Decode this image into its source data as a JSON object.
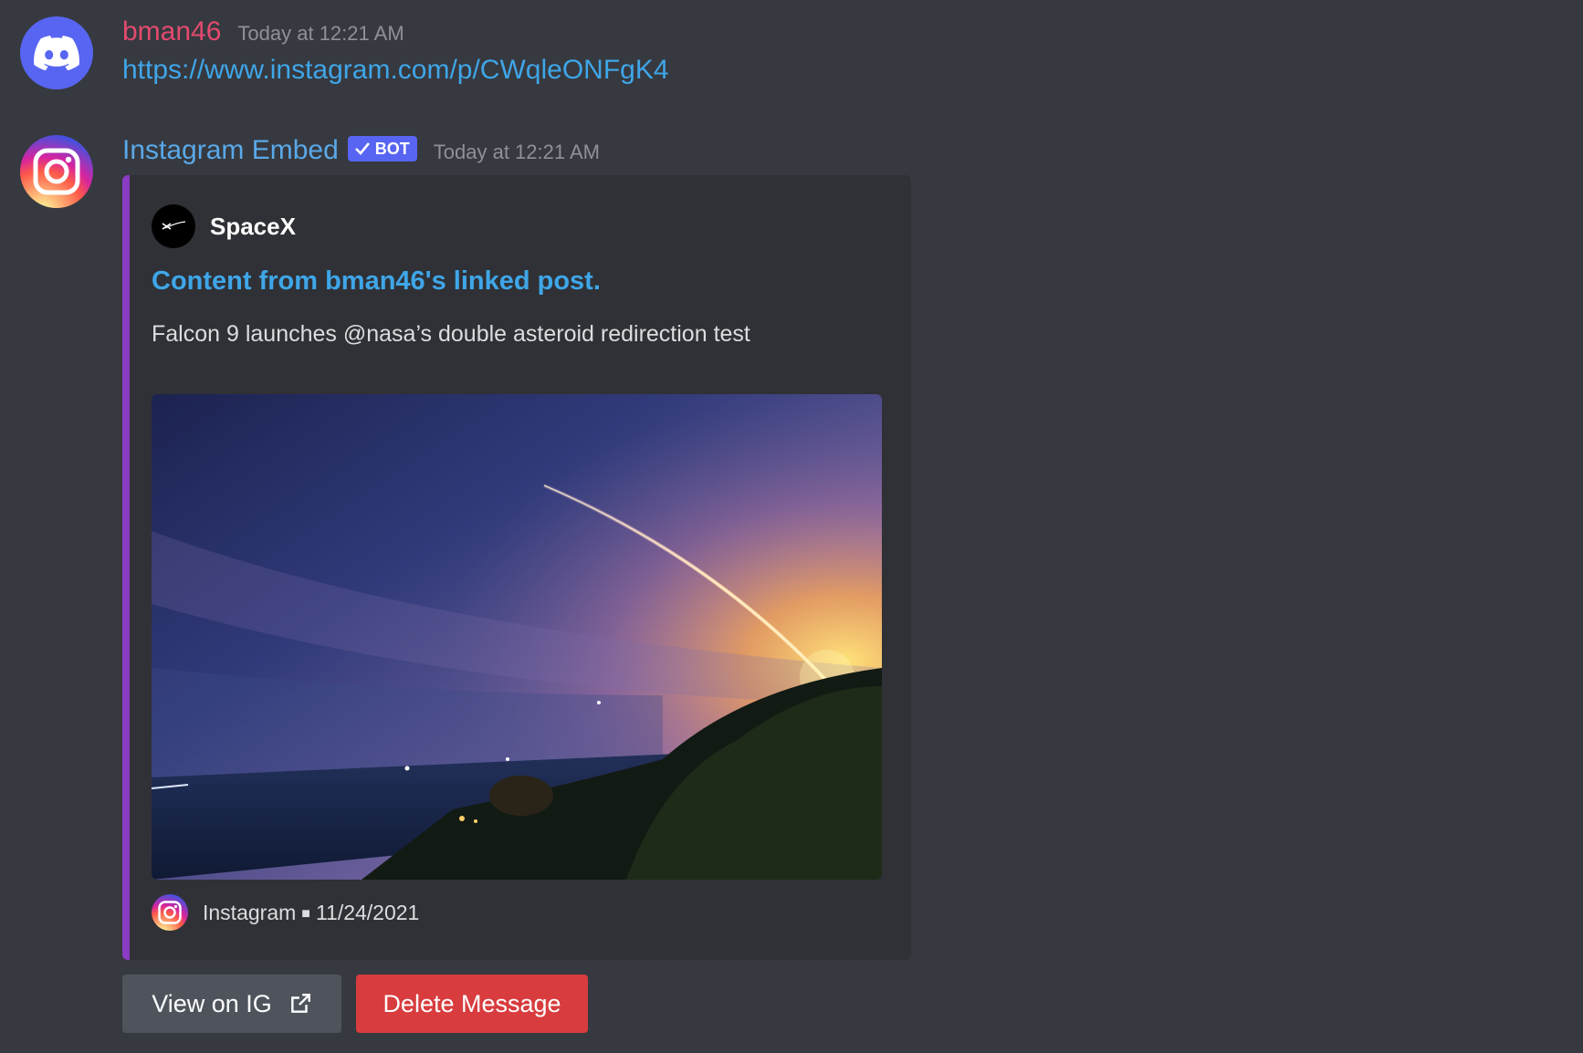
{
  "messages": [
    {
      "username": "bman46",
      "timestamp": "Today at 12:21 AM",
      "avatar_icon": "discord-logo-icon",
      "content_link": "https://www.instagram.com/p/CWqleONFgK4"
    },
    {
      "username": "Instagram Embed",
      "bot_tag": "BOT",
      "timestamp": "Today at 12:21 AM",
      "avatar_icon": "instagram-logo-icon",
      "embed": {
        "accent_color": "#8a3cc2",
        "author": "SpaceX",
        "author_icon": "spacex-logo-icon",
        "title": "Content from bman46's linked post.",
        "description": "Falcon 9 launches @nasa’s double asteroid redirection test",
        "image": "rocket-launch-night-sky-photo",
        "footer_text": "Instagram",
        "footer_date": "11/24/2021",
        "footer_icon": "instagram-logo-icon"
      },
      "buttons": {
        "view_label": "View on IG",
        "view_icon": "external-link-icon",
        "delete_label": "Delete Message"
      }
    }
  ],
  "colors": {
    "background": "#36393f",
    "embed_bg": "#2f3136",
    "link": "#3fa6e8",
    "user_name": "#e34a6f",
    "bot_name": "#5aa8e8",
    "bot_tag": "#5865f2",
    "danger_button": "#d83c3e",
    "secondary_button": "#4f545c"
  }
}
